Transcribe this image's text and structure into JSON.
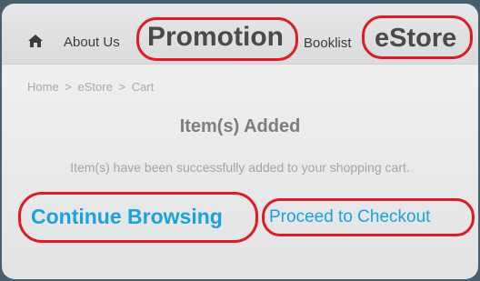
{
  "nav": {
    "items": [
      {
        "label": "About Us"
      },
      {
        "label": "Promotion"
      },
      {
        "label": "Booklist"
      },
      {
        "label": "eStore"
      }
    ]
  },
  "breadcrumb": {
    "items": [
      "Home",
      "eStore",
      "Cart"
    ],
    "separator": ">"
  },
  "main": {
    "title": "Item(s) Added",
    "message": "Item(s) have been successfully added to your shopping cart.",
    "continue_label": "Continue Browsing",
    "checkout_label": "Proceed to Checkout"
  },
  "icons": {
    "home": "home-icon"
  },
  "colors": {
    "link": "#1aa1e0",
    "highlight_ring": "#e01b24",
    "background": "#4a5f6e"
  }
}
